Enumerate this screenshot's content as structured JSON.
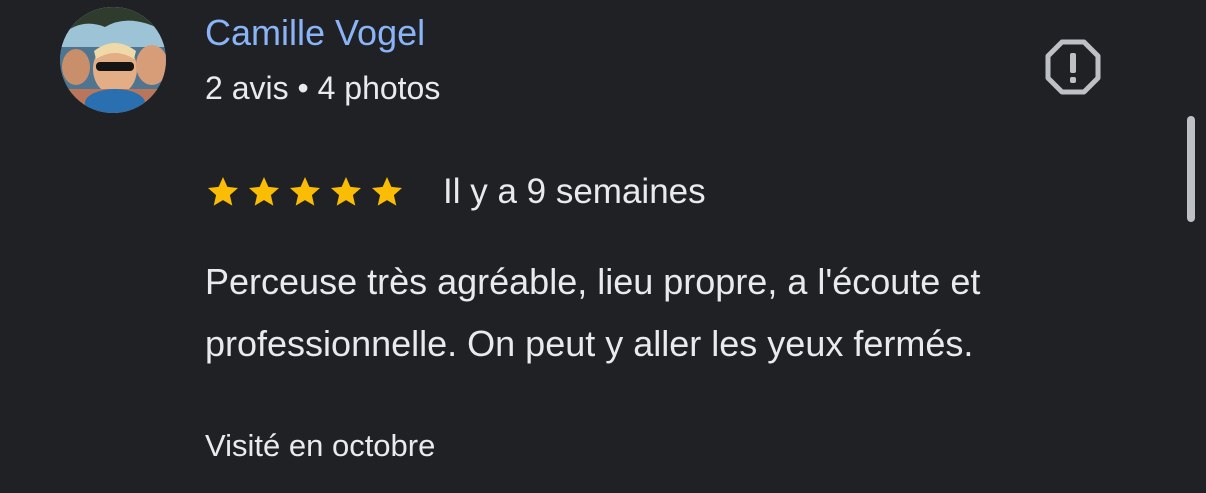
{
  "review": {
    "author_name": "Camille Vogel",
    "author_meta": "2 avis • 4 photos",
    "rating": 5,
    "rating_max": 5,
    "relative_date": "Il y a 9 semaines",
    "text": "Perceuse très agréable, lieu propre, a l'écoute et professionnelle. On peut y aller les yeux fermés.",
    "visited": "Visité en octobre"
  },
  "icons": {
    "report": "report-flag-icon",
    "star": "star-icon"
  },
  "colors": {
    "background": "#202124",
    "author_name": "#8ab4f8",
    "text": "#e8eaed",
    "star": "#fbbc04",
    "icon": "#bdc1c6"
  }
}
